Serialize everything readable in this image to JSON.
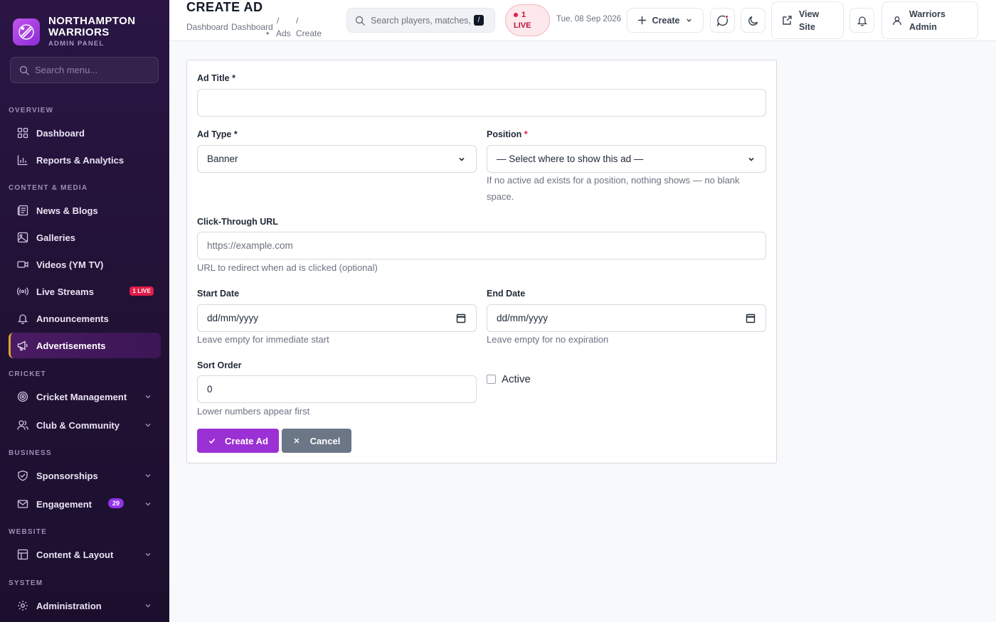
{
  "brand": {
    "name_line1": "NORTHAMPTON",
    "name_line2": "WARRIORS",
    "subtitle": "ADMIN PANEL"
  },
  "sidebar": {
    "search_placeholder": "Search menu...",
    "sections": {
      "overview": "OVERVIEW",
      "content_media": "CONTENT & MEDIA",
      "cricket": "CRICKET",
      "business": "BUSINESS",
      "website": "WEBSITE",
      "system": "SYSTEM"
    },
    "items": {
      "dashboard": "Dashboard",
      "reports": "Reports & Analytics",
      "news": "News & Blogs",
      "galleries": "Galleries",
      "videos": "Videos (YM TV)",
      "live_streams": "Live Streams",
      "live_streams_badge": "1 LIVE",
      "announcements": "Announcements",
      "advertisements": "Advertisements",
      "cricket_mgmt": "Cricket Management",
      "club": "Club & Community",
      "sponsorships": "Sponsorships",
      "engagement": "Engagement",
      "engagement_badge": "29",
      "content_layout": "Content & Layout",
      "administration": "Administration"
    },
    "active_item": "advertisements",
    "accent_color": "#d9a531"
  },
  "header": {
    "title": "CREATE AD",
    "breadcrumb": [
      "Dashboard",
      "Dashboard",
      "/",
      "/",
      "Ads",
      "Create"
    ],
    "search_placeholder": "Search players, matches, n",
    "search_shortcut": "/",
    "live_line1": "1",
    "live_line2": "LIVE",
    "date": "Tue, 08 Sep 2026",
    "create_label": "Create",
    "view_site_line1": "View",
    "view_site_line2": "Site",
    "user_line1": "Warriors",
    "user_line2": "Admin"
  },
  "form": {
    "title_label": "Ad Title",
    "title_value": "",
    "type_label": "Ad Type",
    "type_value": "Banner",
    "position_label": "Position",
    "position_value": "— Select where to show this ad —",
    "position_help_line1": "If no active ad exists for a position, nothing shows — no blank",
    "position_help_line2": "space.",
    "url_label": "Click-Through URL",
    "url_placeholder": "https://example.com",
    "url_help": "URL to redirect when ad is clicked (optional)",
    "start_label": "Start Date",
    "start_placeholder": "dd/mm/yyyy",
    "start_help": "Leave empty for immediate start",
    "end_label": "End Date",
    "end_placeholder": "dd/mm/yyyy",
    "end_help": "Leave empty for no expiration",
    "sort_label": "Sort Order",
    "sort_value": "0",
    "sort_help": "Lower numbers appear first",
    "active_label": "Active",
    "active_checked": false,
    "submit_label": "Create Ad",
    "cancel_label": "Cancel",
    "required_mark": "*"
  },
  "colors": {
    "primary": "#9b30d4",
    "secondary": "#6b7686",
    "live": "#e11d48",
    "sidebar_bg": "#221236"
  }
}
